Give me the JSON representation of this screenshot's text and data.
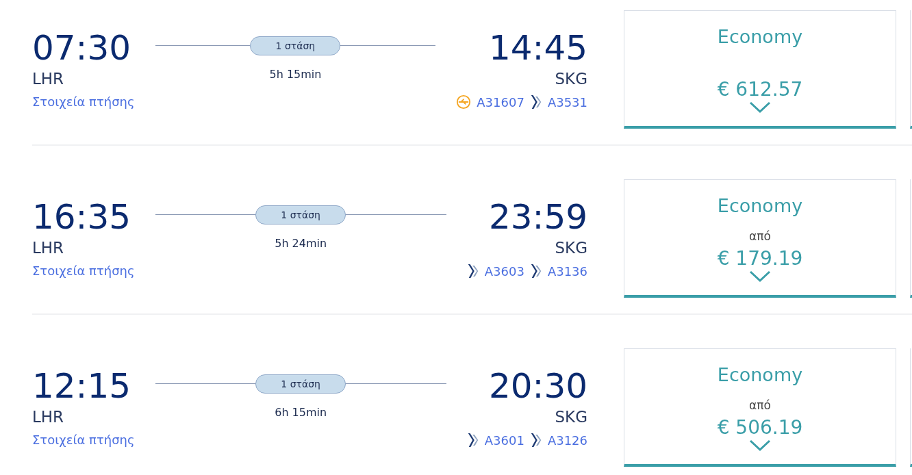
{
  "flights": [
    {
      "departure_time": "07:30",
      "departure_airport": "LHR",
      "details_link": "Στοιχεία πτήσης",
      "stops": "1 στάση",
      "duration": "5h 15min",
      "arrival_time": "14:45",
      "arrival_airport": "SKG",
      "segments": [
        {
          "kind": "orange-circle",
          "code": "A31607"
        },
        {
          "kind": "chevron",
          "code": "A3531"
        }
      ],
      "fare": {
        "cabin": "Economy",
        "price": "€ 612.57"
      }
    },
    {
      "departure_time": "16:35",
      "departure_airport": "LHR",
      "details_link": "Στοιχεία πτήσης",
      "stops": "1 στάση",
      "duration": "5h 24min",
      "arrival_time": "23:59",
      "arrival_airport": "SKG",
      "segments": [
        {
          "kind": "chevron",
          "code": "A3603"
        },
        {
          "kind": "chevron",
          "code": "A3136"
        }
      ],
      "fare": {
        "cabin": "Economy",
        "from_label": "από",
        "price": "€ 179.19"
      }
    },
    {
      "departure_time": "12:15",
      "departure_airport": "LHR",
      "details_link": "Στοιχεία πτήσης",
      "stops": "1 στάση",
      "duration": "6h 15min",
      "arrival_time": "20:30",
      "arrival_airport": "SKG",
      "segments": [
        {
          "kind": "chevron",
          "code": "A3601"
        },
        {
          "kind": "chevron",
          "code": "A3126"
        }
      ],
      "fare": {
        "cabin": "Economy",
        "from_label": "από",
        "price": "€ 506.19"
      }
    }
  ]
}
